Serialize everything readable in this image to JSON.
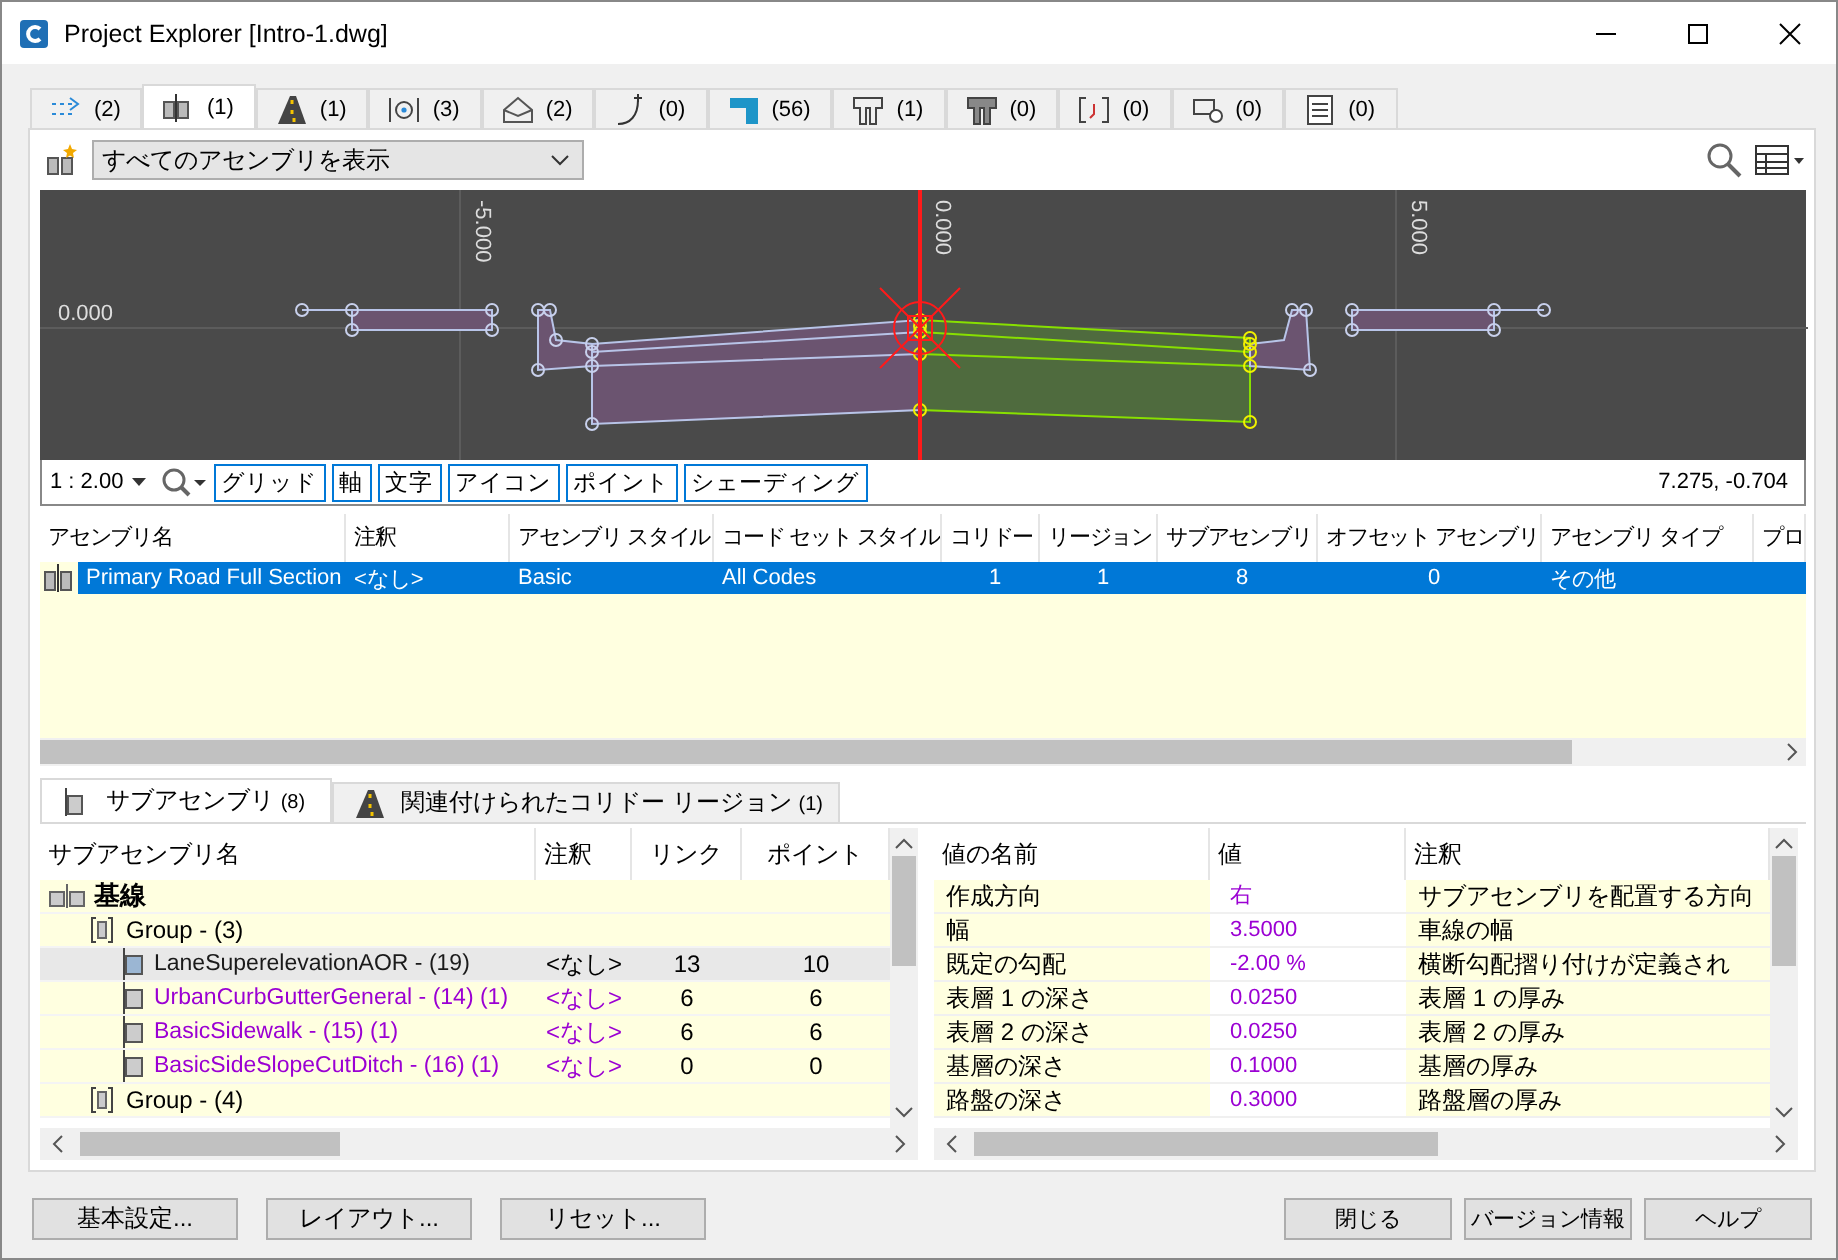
{
  "window": {
    "title": "Project Explorer [Intro-1.dwg]"
  },
  "tabs": [
    {
      "count": "(2)",
      "selected": false
    },
    {
      "count": "(1)",
      "selected": true
    },
    {
      "count": "(1)",
      "selected": false
    },
    {
      "count": "(3)",
      "selected": false
    },
    {
      "count": "(2)",
      "selected": false
    },
    {
      "count": "(0)",
      "selected": false
    },
    {
      "count": "(56)",
      "selected": false
    },
    {
      "count": "(1)",
      "selected": false
    },
    {
      "count": "(0)",
      "selected": false
    },
    {
      "count": "(0)",
      "selected": false
    },
    {
      "count": "(0)",
      "selected": false
    },
    {
      "count": "(0)",
      "selected": false
    }
  ],
  "toolbar": {
    "filter": "すべてのアセンブリを表示"
  },
  "viewer": {
    "x_axis_labels": [
      "-5.000",
      "0.000",
      "5.000"
    ],
    "y_axis_label": "0.000",
    "scale": "1 : 2.00",
    "toggles": [
      "グリッド",
      "軸",
      "文字",
      "アイコン",
      "ポイント",
      "シェーディング"
    ],
    "coordinates": "7.275, -0.704"
  },
  "assemblies": {
    "columns": [
      "アセンブリ名",
      "注釈",
      "アセンブリ スタイル",
      "コード セット スタイル",
      "コリドー",
      "リージョン",
      "サブアセンブリ",
      "オフセット アセンブリ",
      "アセンブリ タイプ",
      "プロ"
    ],
    "rows": [
      {
        "cells": [
          "Primary Road Full Section",
          "<なし>",
          "Basic",
          "All Codes",
          "1",
          "1",
          "8",
          "0",
          "その他"
        ],
        "selected": true
      }
    ]
  },
  "detail_tabs": [
    {
      "label": "サブアセンブリ",
      "count": "(8)",
      "selected": true
    },
    {
      "label": "関連付けられたコリドー リージョン",
      "count": "(1)",
      "selected": false
    }
  ],
  "subassemblies": {
    "columns": [
      "サブアセンブリ名",
      "注釈",
      "リンク",
      "ポイント"
    ],
    "items": [
      {
        "name": "基線",
        "kind": "baseline",
        "selected": false,
        "children": [
          {
            "name": "Group - (3)",
            "kind": "group",
            "selected": false,
            "children": [
              {
                "name": "LaneSuperelevationAOR - (19)",
                "kind": "subassembly",
                "note": "<なし>",
                "links": "13",
                "points": "10",
                "selected": true,
                "color": "#1a1a1a"
              },
              {
                "name": "UrbanCurbGutterGeneral - (14) (1)",
                "kind": "subassembly",
                "note": "<なし>",
                "links": "6",
                "points": "6",
                "selected": false,
                "color": "#9b00d3"
              },
              {
                "name": "BasicSidewalk - (15) (1)",
                "kind": "subassembly",
                "note": "<なし>",
                "links": "6",
                "points": "6",
                "selected": false,
                "color": "#9b00d3"
              },
              {
                "name": "BasicSideSlopeCutDitch - (16) (1)",
                "kind": "subassembly",
                "note": "<なし>",
                "links": "0",
                "points": "0",
                "selected": false,
                "color": "#9b00d3"
              }
            ]
          },
          {
            "name": "Group - (4)",
            "kind": "group",
            "selected": false
          }
        ]
      }
    ]
  },
  "parameters": {
    "columns": [
      "値の名前",
      "値",
      "注釈"
    ],
    "rows": [
      {
        "name": "作成方向",
        "value": "右",
        "note": "サブアセンブリを配置する方向"
      },
      {
        "name": "幅",
        "value": "3.5000",
        "note": "車線の幅"
      },
      {
        "name": "既定の勾配",
        "value": "-2.00 %",
        "note": "横断勾配摺り付けが定義され"
      },
      {
        "name": "表層 1 の深さ",
        "value": "0.0250",
        "note": "表層 1 の厚み"
      },
      {
        "name": "表層 2 の深さ",
        "value": "0.0250",
        "note": "表層 2 の厚み"
      },
      {
        "name": "基層の深さ",
        "value": "0.1000",
        "note": "基層の厚み"
      },
      {
        "name": "路盤の深さ",
        "value": "0.3000",
        "note": "路盤層の厚み"
      }
    ]
  },
  "buttons_left": [
    "基本設定...",
    "レイアウト...",
    "リセット..."
  ],
  "buttons_right": [
    "閉じる",
    "バージョン情報",
    "ヘルプ"
  ]
}
